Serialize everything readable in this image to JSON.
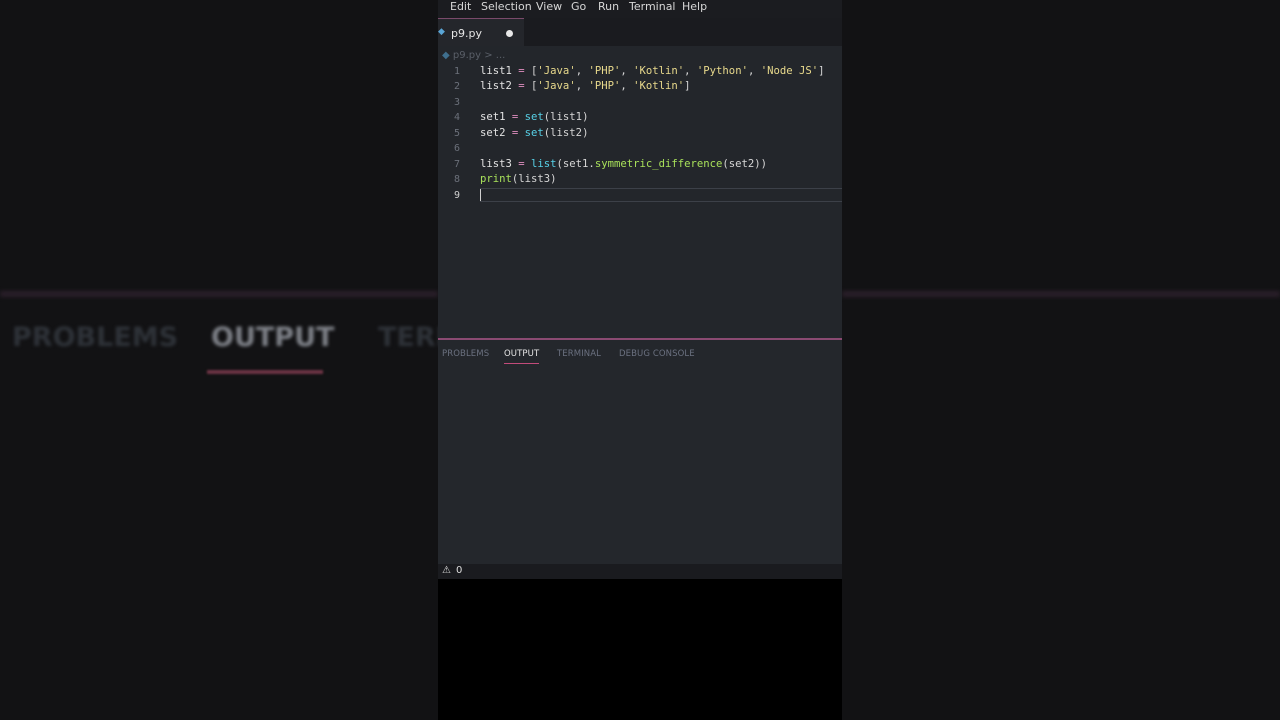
{
  "menu": [
    "Edit",
    "Selection",
    "View",
    "Go",
    "Run",
    "Terminal",
    "Help"
  ],
  "tab": {
    "filename": "p9.py"
  },
  "breadcrumb": {
    "file": "p9.py",
    "rest": "> ..."
  },
  "code": {
    "line_numbers": [
      "1",
      "2",
      "3",
      "4",
      "5",
      "6",
      "7",
      "8",
      "9"
    ],
    "line1": [
      "list1",
      " = ",
      "[",
      "'Java'",
      ", ",
      "'PHP'",
      ", ",
      "'Kotlin'",
      ", ",
      "'Python'",
      ", ",
      "'Node JS'",
      "]"
    ],
    "line2": [
      "list2",
      " = ",
      "[",
      "'Java'",
      ", ",
      "'PHP'",
      ", ",
      "'Kotlin'",
      "]"
    ],
    "line4": [
      "set1",
      " = ",
      "set",
      "(list1)"
    ],
    "line5": [
      "set2",
      " = ",
      "set",
      "(list2)"
    ],
    "line7": [
      "list3",
      " = ",
      "list",
      "(set1.",
      "symmetric_difference",
      "(set2))"
    ],
    "line8": [
      "print",
      "(list3)"
    ]
  },
  "panel": {
    "tabs": [
      "PROBLEMS",
      "OUTPUT",
      "TERMINAL",
      "DEBUG CONSOLE"
    ],
    "active": "OUTPUT"
  },
  "status": {
    "warnings": "0"
  },
  "background": {
    "tabs": [
      "PROBLEMS",
      "OUTPUT",
      "TERM"
    ]
  },
  "colors": {
    "accent": "#c24b7a",
    "editor_bg": "#23262b",
    "string": "#e8d98c",
    "function": "#57d0e6"
  }
}
